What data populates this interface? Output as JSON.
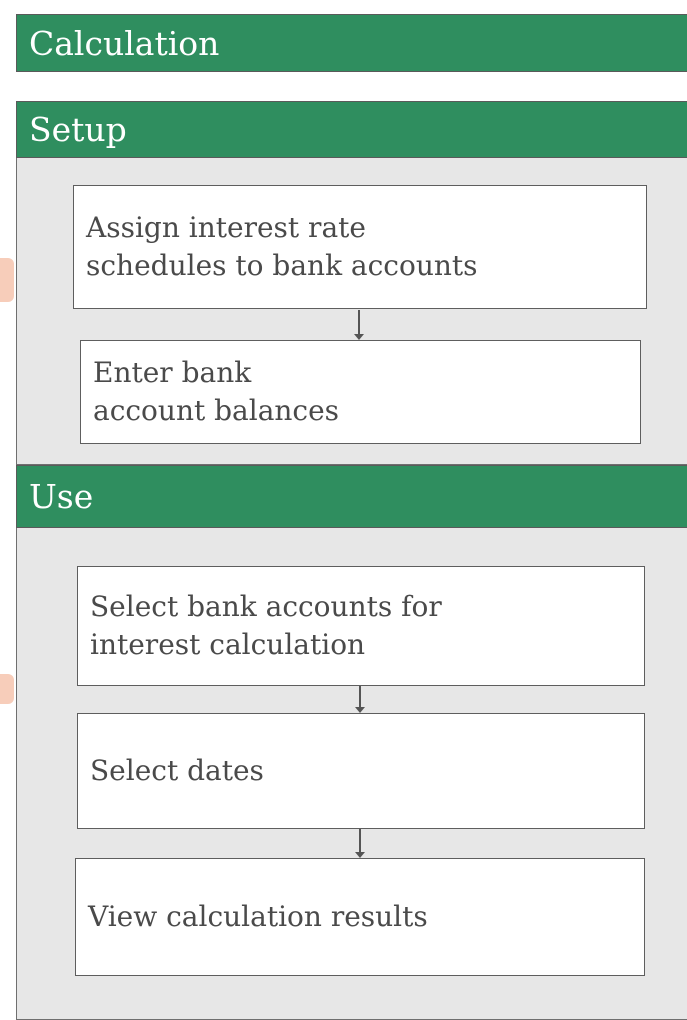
{
  "sections": {
    "calculation": {
      "title": "Calculation"
    },
    "setup": {
      "title": "Setup",
      "steps": [
        "Assign interest rate\nschedules to bank accounts",
        "Enter bank\naccount balances"
      ]
    },
    "use": {
      "title": "Use",
      "steps": [
        "Select bank accounts for\ninterest calculation",
        "Select dates",
        "View calculation results"
      ]
    }
  },
  "colors": {
    "header_green": "#2f8e5f",
    "panel_gray": "#e7e7e7",
    "box_border": "#5e5e5e",
    "watermark_orange": "#e8703a"
  }
}
